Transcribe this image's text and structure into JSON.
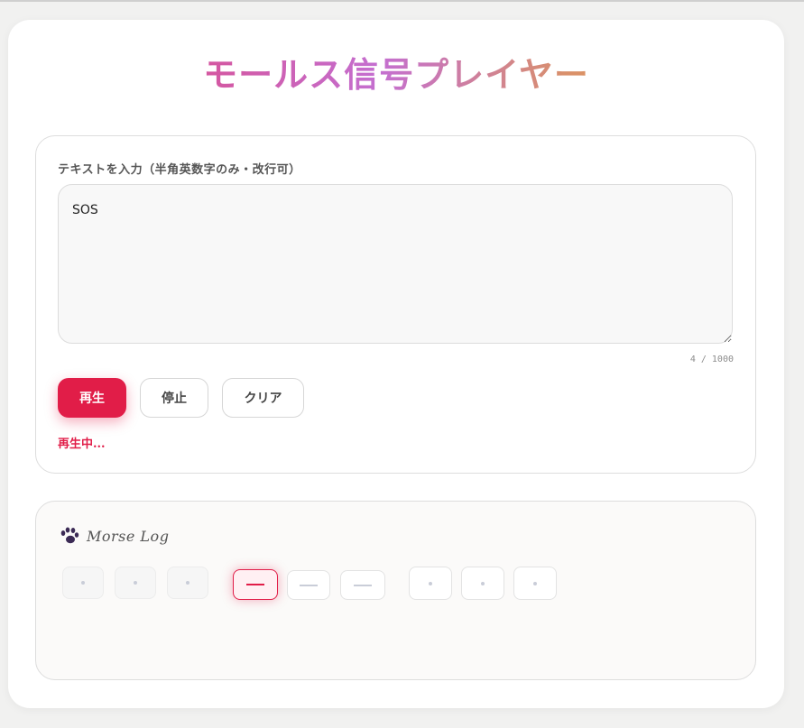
{
  "app": {
    "title": "モールス信号プレイヤー"
  },
  "input": {
    "label": "テキストを入力（半角英数字のみ・改行可）",
    "value": "SOS",
    "counter": "4 / 1000"
  },
  "controls": {
    "play_label": "再生",
    "stop_label": "停止",
    "clear_label": "クリア"
  },
  "status": {
    "text": "再生中..."
  },
  "log": {
    "title": "Morse Log",
    "icon": "paw-icon",
    "symbols": [
      {
        "type": "dot",
        "state": "played"
      },
      {
        "type": "dot",
        "state": "played"
      },
      {
        "type": "dot",
        "state": "played"
      },
      {
        "type": "dash",
        "state": "active"
      },
      {
        "type": "dash",
        "state": "pending"
      },
      {
        "type": "dash",
        "state": "pending"
      },
      {
        "type": "dot",
        "state": "pending"
      },
      {
        "type": "dot",
        "state": "pending"
      },
      {
        "type": "dot",
        "state": "pending"
      }
    ]
  },
  "colors": {
    "accent": "#e11d48",
    "symbol_mark": "#c9cdd8",
    "title_gradient": [
      "#e63b6a",
      "#c46fd0",
      "#d9906a",
      "#f0a530"
    ]
  }
}
